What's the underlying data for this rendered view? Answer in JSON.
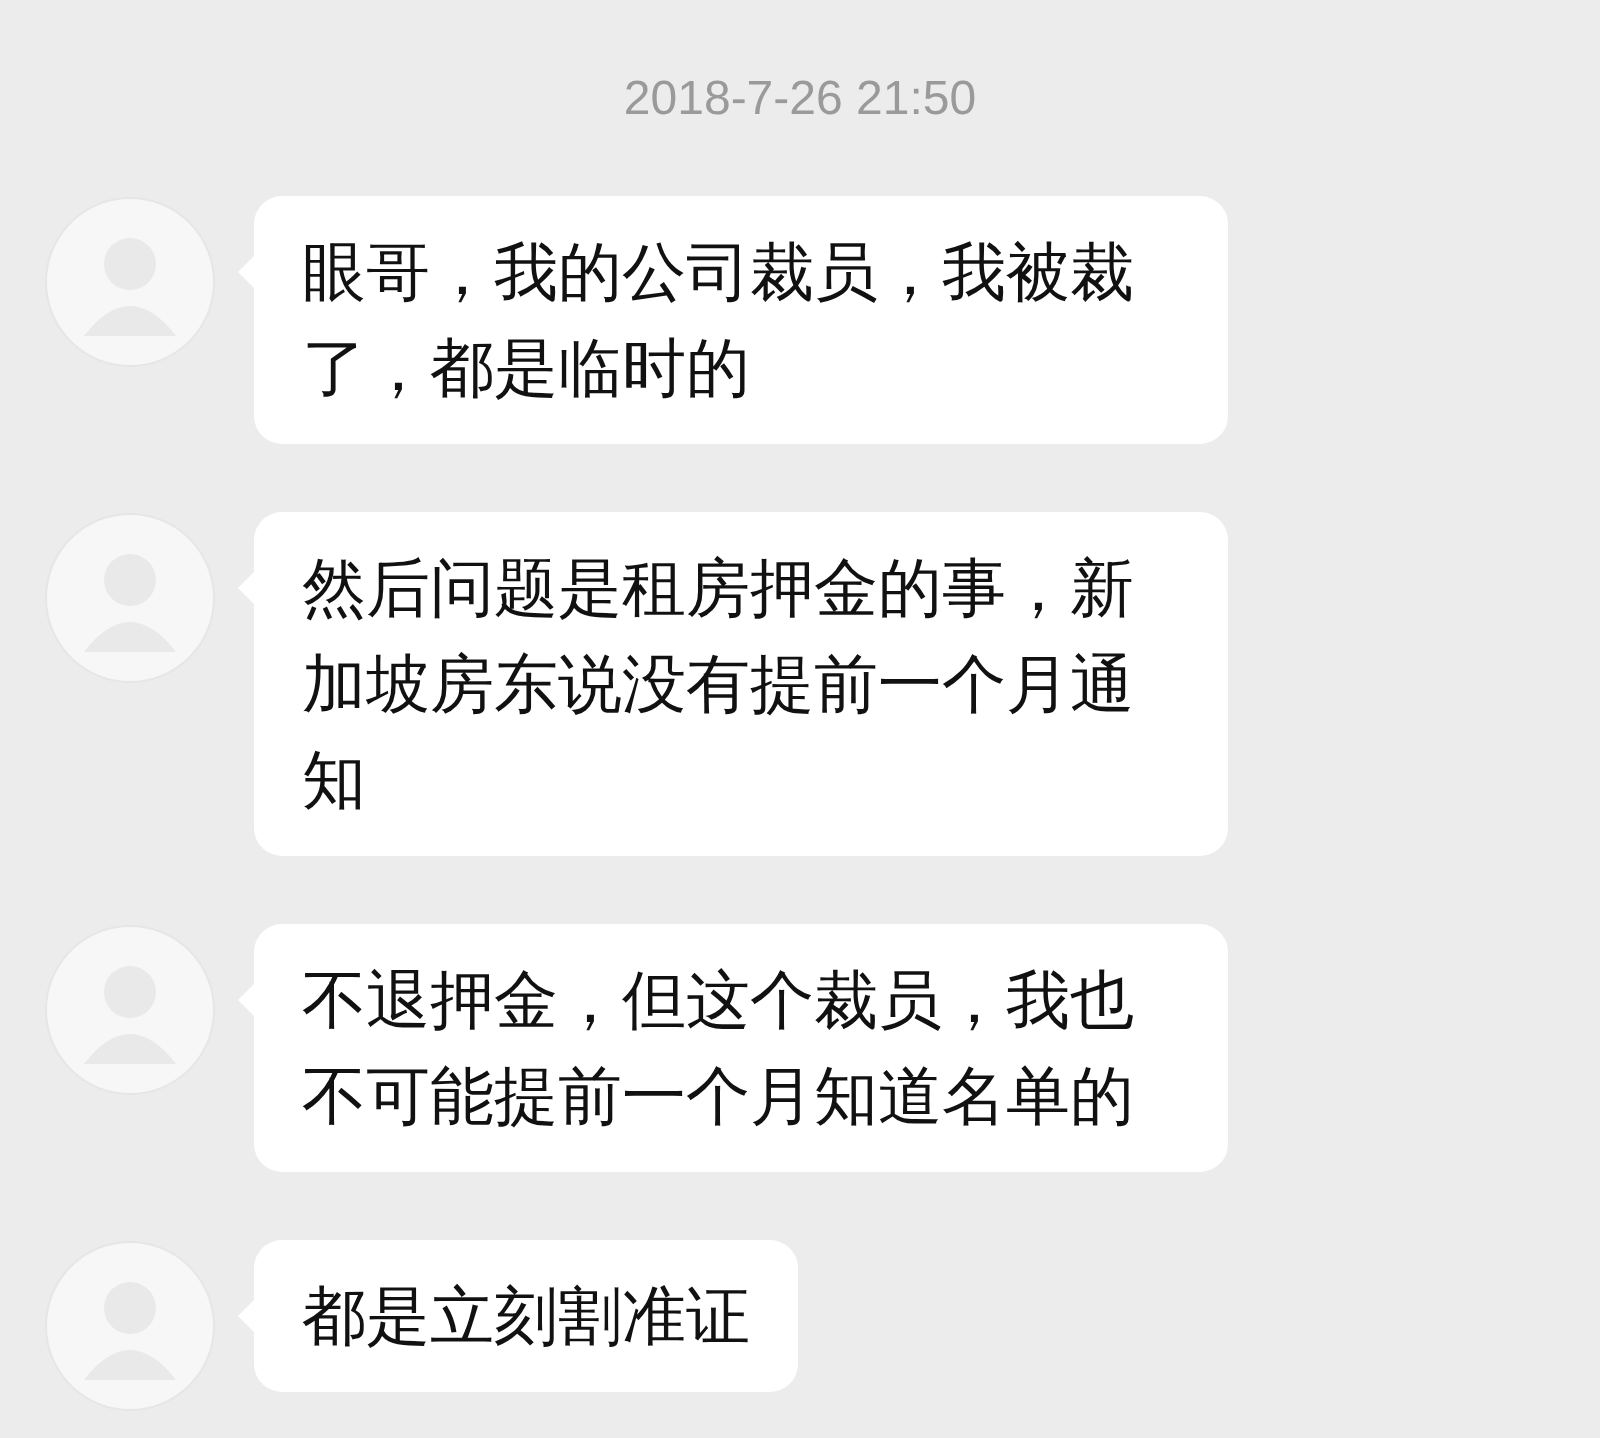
{
  "timestamp": "2018-7-26 21:50",
  "messages": [
    {
      "text": "眼哥，我的公司裁员，我被裁了，都是临时的"
    },
    {
      "text": "然后问题是租房押金的事，新加坡房东说没有提前一个月通知"
    },
    {
      "text": "不退押金，但这个裁员，我也不可能提前一个月知道名单的"
    },
    {
      "text": "都是立刻割准证"
    }
  ]
}
